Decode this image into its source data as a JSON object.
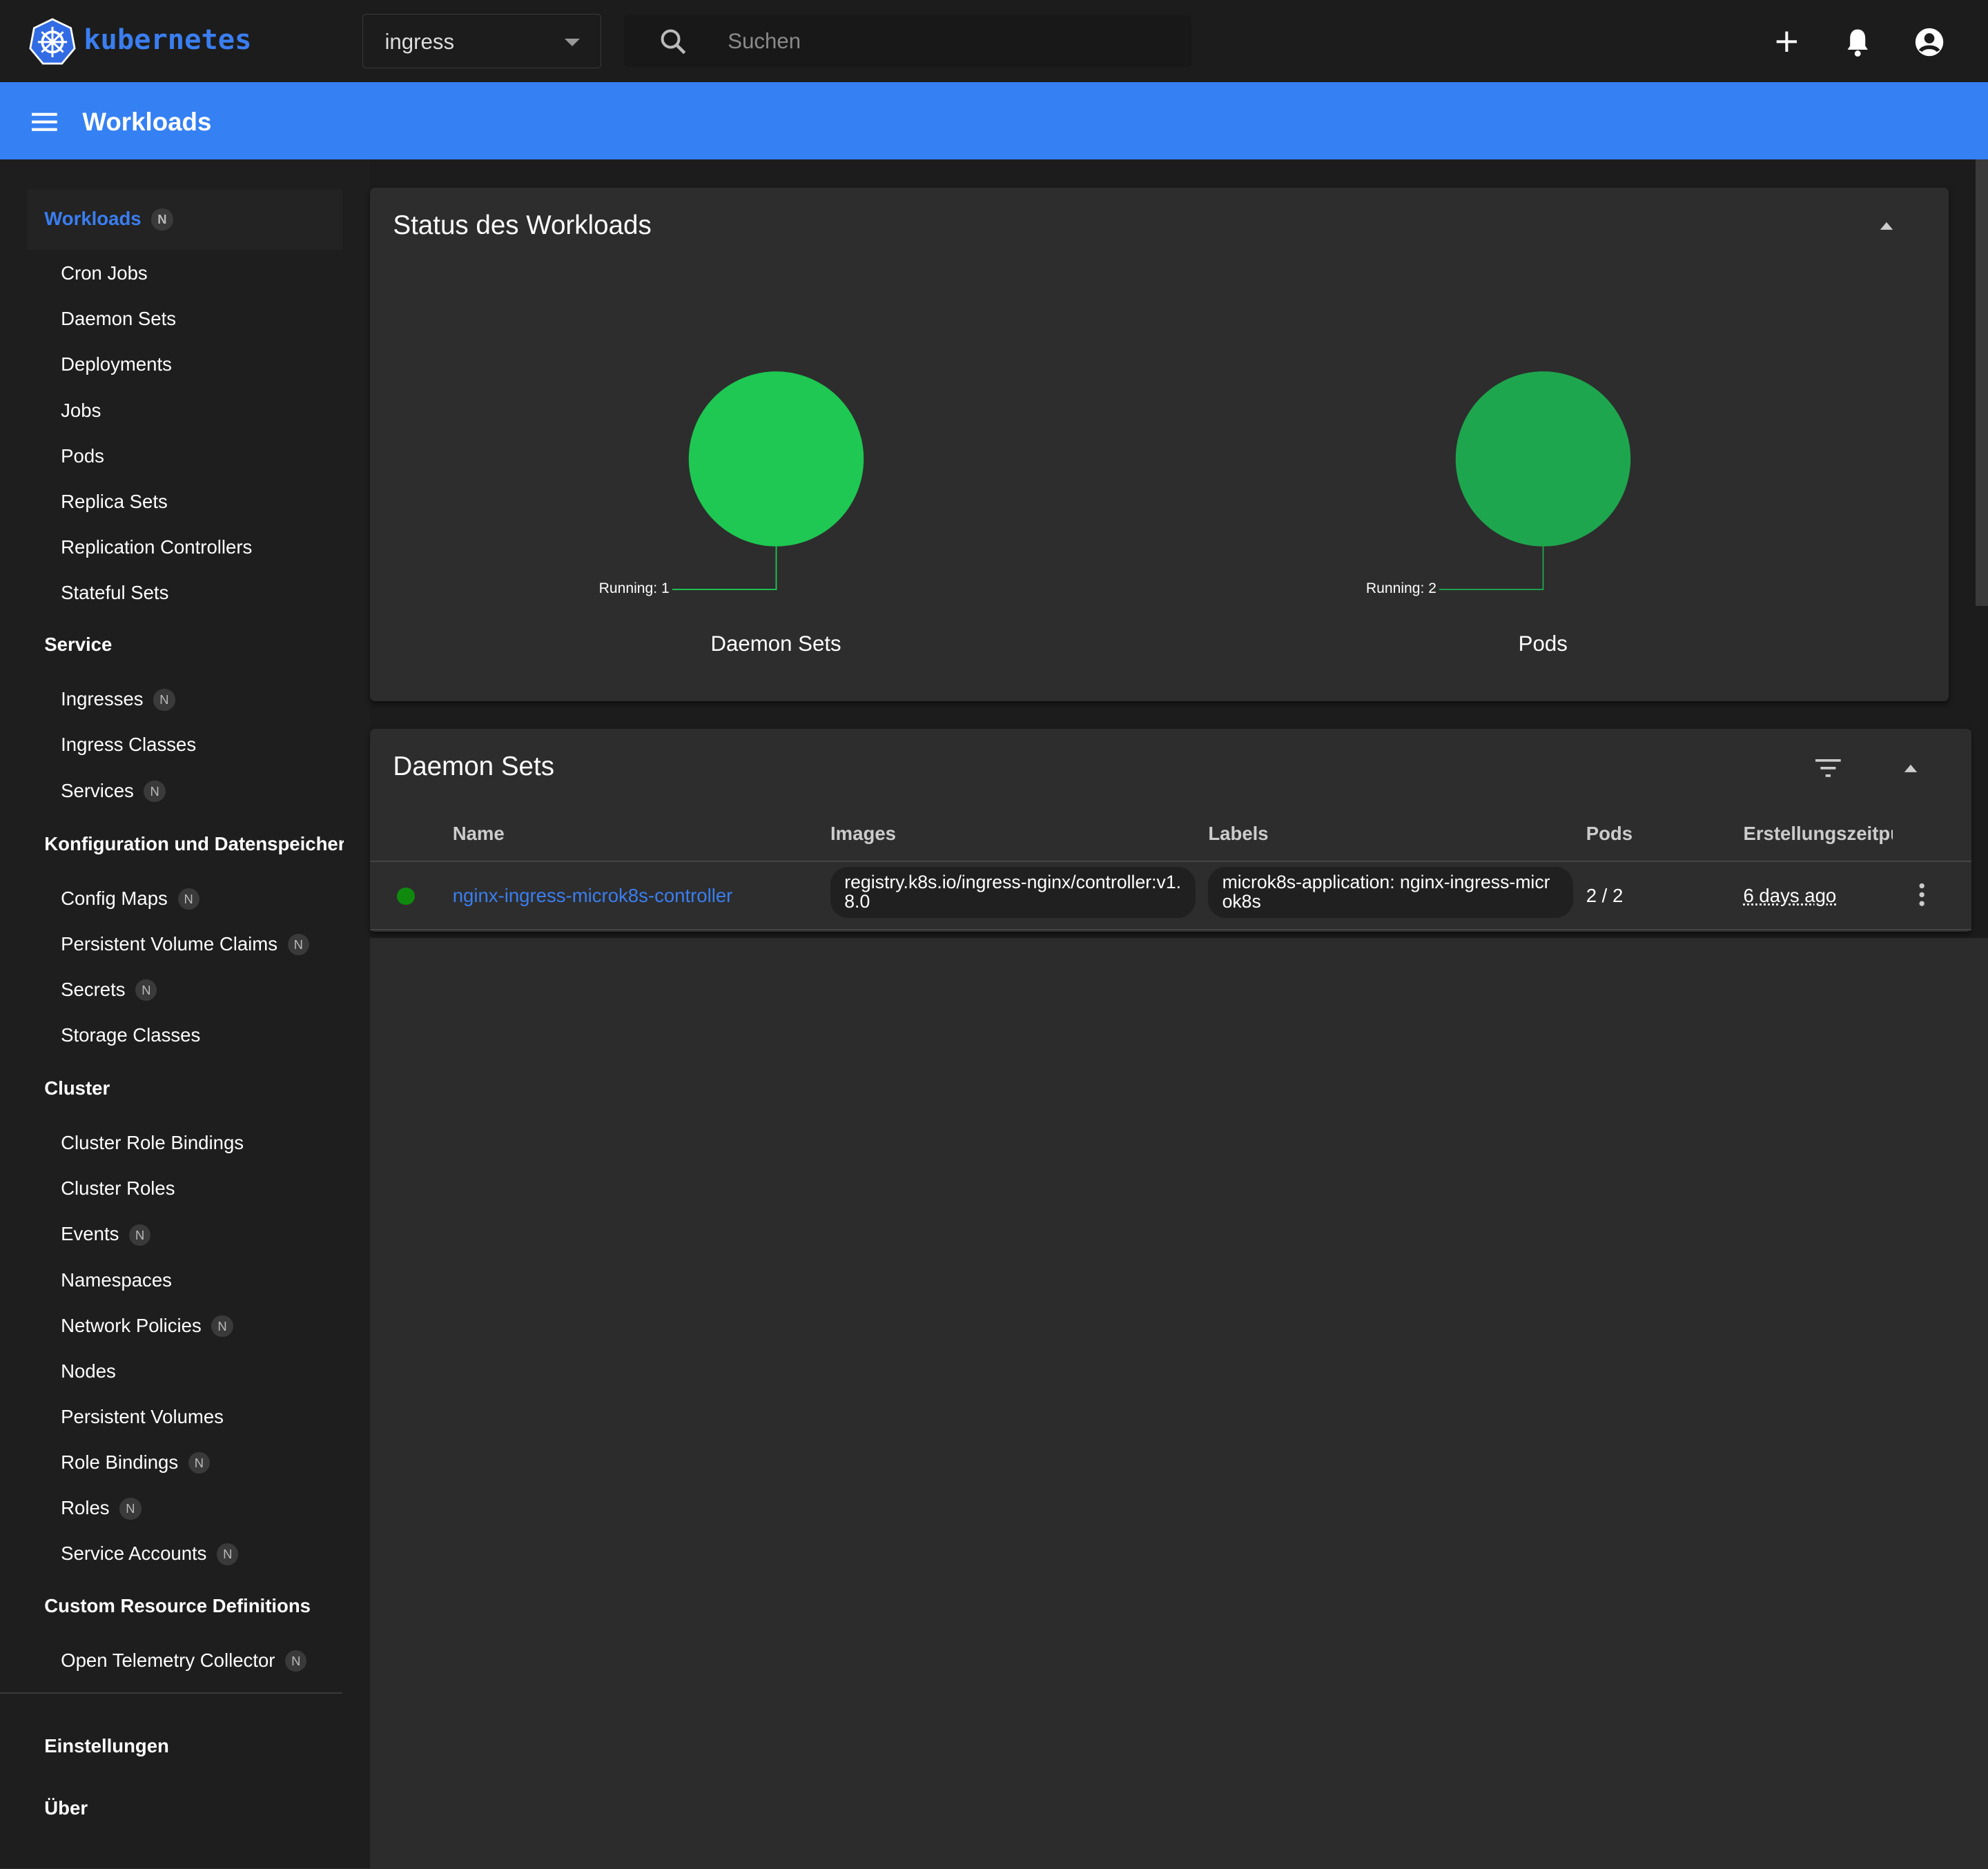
{
  "topbar": {
    "logo": "kubernetes",
    "namespace": "ingress",
    "search_placeholder": "Suchen",
    "icons": [
      "plus-icon",
      "bell-icon",
      "account-icon"
    ]
  },
  "header": {
    "title": "Workloads"
  },
  "sidebar": {
    "workloads": {
      "label": "Workloads",
      "badge": "N"
    },
    "workload_items": [
      {
        "label": "Cron Jobs"
      },
      {
        "label": "Daemon Sets"
      },
      {
        "label": "Deployments"
      },
      {
        "label": "Jobs"
      },
      {
        "label": "Pods"
      },
      {
        "label": "Replica Sets"
      },
      {
        "label": "Replication Controllers"
      },
      {
        "label": "Stateful Sets"
      }
    ],
    "service": {
      "label": "Service",
      "items": [
        {
          "label": "Ingresses",
          "badge": "N"
        },
        {
          "label": "Ingress Classes"
        },
        {
          "label": "Services",
          "badge": "N"
        }
      ]
    },
    "config": {
      "label": "Konfiguration und Datenspeicherung",
      "items": [
        {
          "label": "Config Maps",
          "badge": "N"
        },
        {
          "label": "Persistent Volume Claims",
          "badge": "N"
        },
        {
          "label": "Secrets",
          "badge": "N"
        },
        {
          "label": "Storage Classes"
        }
      ]
    },
    "cluster": {
      "label": "Cluster",
      "items": [
        {
          "label": "Cluster Role Bindings"
        },
        {
          "label": "Cluster Roles"
        },
        {
          "label": "Events",
          "badge": "N"
        },
        {
          "label": "Namespaces"
        },
        {
          "label": "Network Policies",
          "badge": "N"
        },
        {
          "label": "Nodes"
        },
        {
          "label": "Persistent Volumes"
        },
        {
          "label": "Role Bindings",
          "badge": "N"
        },
        {
          "label": "Roles",
          "badge": "N"
        },
        {
          "label": "Service Accounts",
          "badge": "N"
        }
      ]
    },
    "crd": {
      "label": "Custom Resource Definitions",
      "items": [
        {
          "label": "Open Telemetry Collector",
          "badge": "N"
        }
      ]
    },
    "settings": "Einstellungen",
    "about": "Über"
  },
  "status_card": {
    "title": "Status des Workloads",
    "charts": [
      {
        "name": "Daemon Sets",
        "label": "Running: 1",
        "running": 1,
        "color": "#1ec852"
      },
      {
        "name": "Pods",
        "label": "Running: 2",
        "running": 2,
        "color": "#1ea64e"
      }
    ]
  },
  "daemon_sets": {
    "title": "Daemon Sets",
    "columns": [
      "Name",
      "Images",
      "Labels",
      "Pods",
      "Erstellungszeitpunkt"
    ],
    "rows": [
      {
        "status": "running",
        "status_color": "#0f8a0f",
        "name": "nginx-ingress-microk8s-controller",
        "image": "registry.k8s.io/ingress-nginx/controller:v1.8.0",
        "label": "microk8s-application: nginx-ingress-microk8s",
        "pods": "2 / 2",
        "age": "6 days ago"
      }
    ]
  },
  "colors": {
    "accent": "#3580f3",
    "link": "#3a7ef0"
  }
}
